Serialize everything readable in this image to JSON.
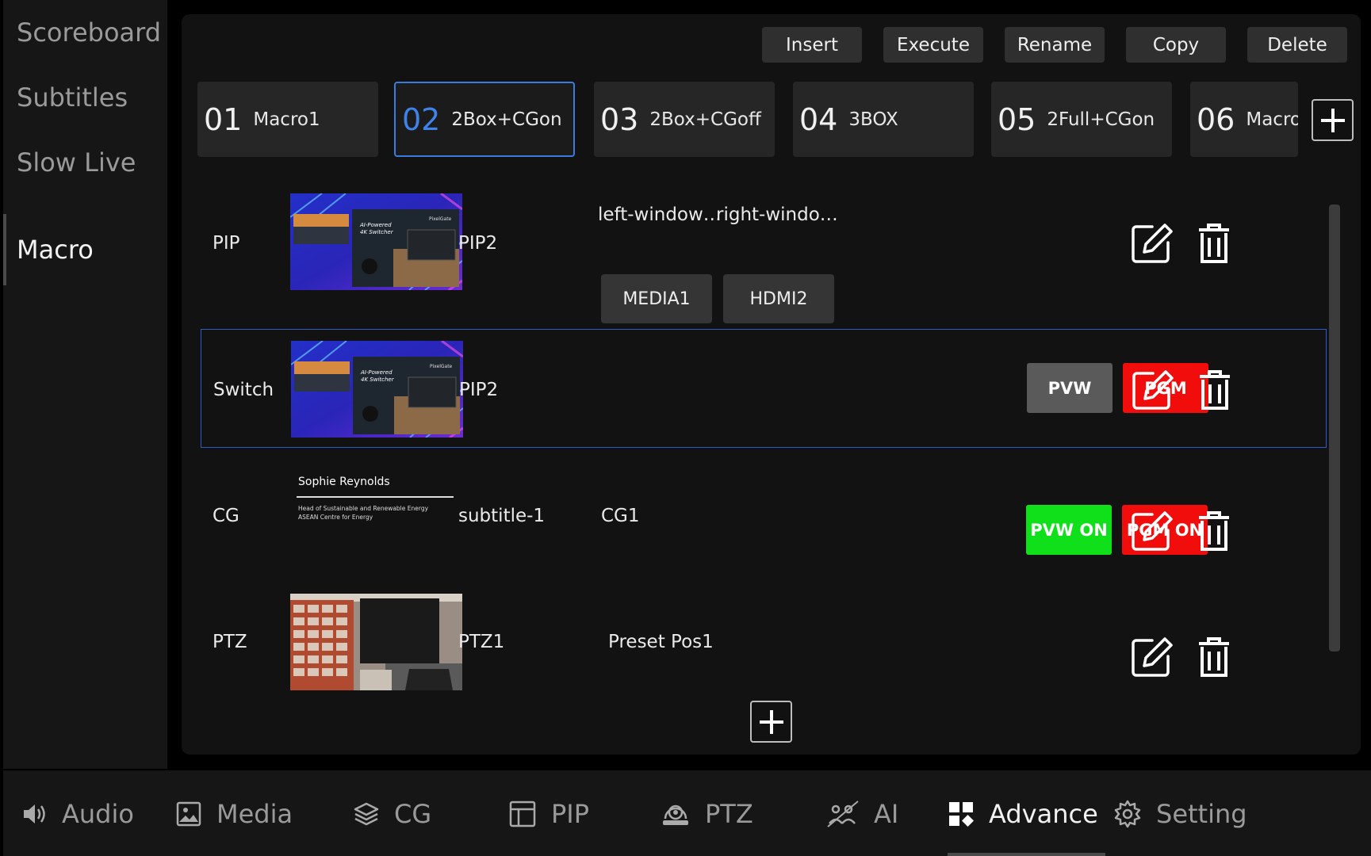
{
  "sidebar": {
    "items": [
      {
        "label": "Scoreboard"
      },
      {
        "label": "Subtitles"
      },
      {
        "label": "Slow Live"
      },
      {
        "label": "Macro"
      }
    ]
  },
  "toolbar": {
    "insert": "Insert",
    "execute": "Execute",
    "rename": "Rename",
    "copy": "Copy",
    "delete": "Delete"
  },
  "macro_tabs": [
    {
      "num": "01",
      "name": "Macro1"
    },
    {
      "num": "02",
      "name": "2Box+CGon"
    },
    {
      "num": "03",
      "name": "2Box+CGoff"
    },
    {
      "num": "04",
      "name": "3BOX"
    },
    {
      "num": "05",
      "name": "2Full+CGon"
    },
    {
      "num": "06",
      "name": "Macro"
    }
  ],
  "rows": {
    "pip": {
      "label": "PIP",
      "source": "PIP2",
      "left_window": "left-window…",
      "right_window": "right-windo…",
      "left_src": "MEDIA1",
      "right_src": "HDMI2"
    },
    "switch": {
      "label": "Switch",
      "source": "PIP2",
      "pvw": "PVW",
      "pgm": "PGM"
    },
    "cg": {
      "label": "CG",
      "source": "subtitle-1",
      "target": "CG1",
      "pvw_on": "PVW ON",
      "pgm_on": "PGM ON",
      "preview_name": "Sophie Reynolds",
      "preview_line1": "Head of Sustainable and Renewable Energy",
      "preview_line2": "ASEAN Centre for Energy"
    },
    "ptz": {
      "label": "PTZ",
      "source": "PTZ1",
      "preset": "Preset Pos1"
    }
  },
  "thumbnail_text": {
    "title1": "AI-Powered",
    "title2": "4K Switcher",
    "brand": "PixelGate"
  },
  "bottom_nav": [
    {
      "label": "Audio",
      "icon": "speaker-icon"
    },
    {
      "label": "Media",
      "icon": "image-icon"
    },
    {
      "label": "CG",
      "icon": "layers-icon"
    },
    {
      "label": "PIP",
      "icon": "layout-icon"
    },
    {
      "label": "PTZ",
      "icon": "camera-icon"
    },
    {
      "label": "AI",
      "icon": "ai-icon"
    },
    {
      "label": "Advance",
      "icon": "grid-icon"
    },
    {
      "label": "Setting",
      "icon": "gear-icon"
    }
  ],
  "colors": {
    "accent": "#3f82ea",
    "pgm": "#f20d0d",
    "pvw_on": "#10e01a",
    "pvw": "#5a5a5a"
  }
}
